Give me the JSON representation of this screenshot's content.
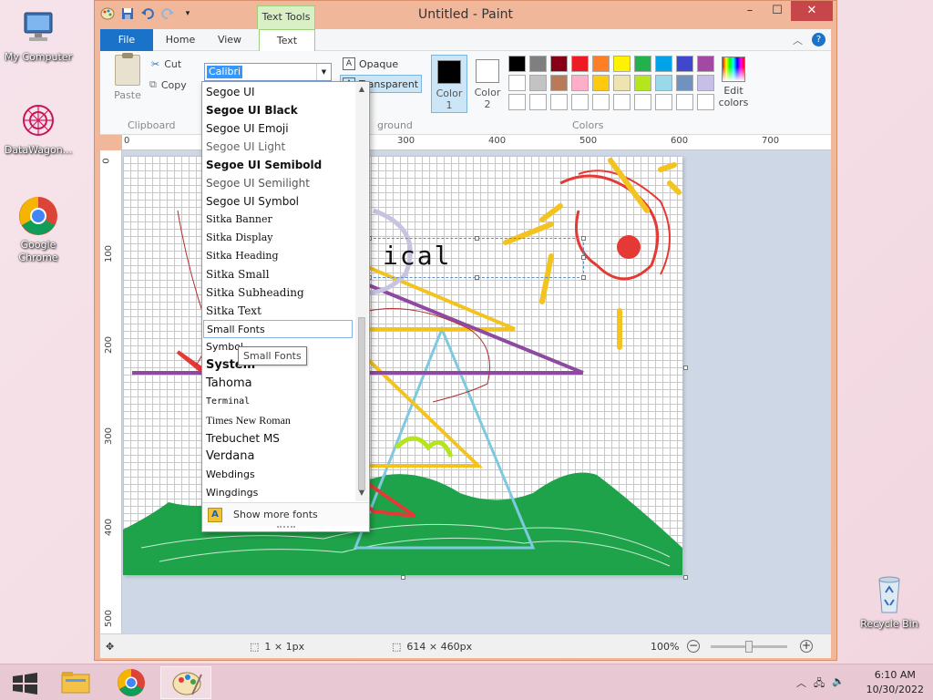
{
  "desktop": {
    "icons": [
      {
        "label": "My Computer"
      },
      {
        "label": "DataWagon..."
      },
      {
        "label": "Google Chrome"
      },
      {
        "label": "Recycle Bin"
      }
    ]
  },
  "window": {
    "title": "Untitled - Paint",
    "contextual_tab": "Text Tools"
  },
  "ribbon": {
    "tabs": [
      "File",
      "Home",
      "View",
      "Text"
    ],
    "active_tab": "Text",
    "clipboard": {
      "paste": "Paste",
      "cut": "Cut",
      "copy": "Copy",
      "group": "Clipboard"
    },
    "font": {
      "selected": "Calibri"
    },
    "background": {
      "opaque": "Opaque",
      "transparent": "Transparent",
      "group_partial": "ground"
    },
    "colors": {
      "color1_label": "Color",
      "color1_num": "1",
      "color2_label": "Color",
      "color2_num": "2",
      "color1_value": "#000000",
      "color2_value": "#ffffff",
      "group": "Colors",
      "edit_label_1": "Edit",
      "edit_label_2": "colors",
      "palette": [
        "#000000",
        "#7f7f7f",
        "#880015",
        "#ed1c24",
        "#ff7f27",
        "#fff200",
        "#22b14c",
        "#00a2e8",
        "#3f48cc",
        "#a349a4",
        "#ffffff",
        "#c3c3c3",
        "#b97a57",
        "#ffaec9",
        "#ffc90e",
        "#efe4b0",
        "#b5e61d",
        "#99d9ea",
        "#7092be",
        "#c8bfe7",
        "#ffffff",
        "#ffffff",
        "#ffffff",
        "#ffffff",
        "#ffffff",
        "#ffffff",
        "#ffffff",
        "#ffffff",
        "#ffffff",
        "#ffffff"
      ]
    }
  },
  "rulers": {
    "h": [
      "0",
      "300",
      "400",
      "500",
      "600",
      "700"
    ],
    "v": [
      "0",
      "100",
      "200",
      "300",
      "400",
      "500"
    ]
  },
  "canvas": {
    "text_entry": "ical"
  },
  "font_dropdown": {
    "items": [
      "Segoe UI",
      "Segoe UI Black",
      "Segoe UI Emoji",
      "Segoe UI Light",
      "Segoe UI Semibold",
      "Segoe UI Semilight",
      "Segoe UI Symbol",
      "Sitka Banner",
      "Sitka Display",
      "Sitka Heading",
      "Sitka Small",
      "Sitka Subheading",
      "Sitka Text",
      "Small Fonts",
      "Symbol",
      "System",
      "Tahoma",
      "Terminal",
      "Times New Roman",
      "Trebuchet MS",
      "Verdana",
      "Webdings",
      "Wingdings"
    ],
    "hovered": "Small Fonts",
    "tooltip": "Small Fonts",
    "footer": "Show more fonts"
  },
  "statusbar": {
    "pen_size": "1 × 1px",
    "canvas_size": "614 × 460px",
    "zoom": "100%",
    "zoom_level": 1.0
  },
  "taskbar": {
    "time": "6:10 AM",
    "date": "10/30/2022"
  }
}
